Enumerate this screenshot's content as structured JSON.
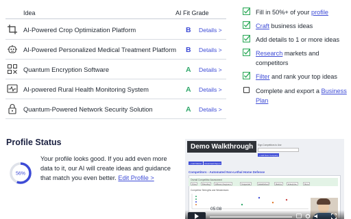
{
  "table": {
    "headers": {
      "idea": "Idea",
      "grade": "AI Fit Grade"
    },
    "rows": [
      {
        "name": "AI-Powered Crop Optimization Platform",
        "grade": "B",
        "details": "Details >"
      },
      {
        "name": "AI-Powered Personalized Medical Treatment Platform",
        "grade": "B",
        "details": "Details >"
      },
      {
        "name": "Quantum Encryption Software",
        "grade": "A",
        "details": "Details >"
      },
      {
        "name": "AI-powered Rural Health Monitoring System",
        "grade": "A",
        "details": "Details >"
      },
      {
        "name": "Quantum-Powered Network Security Solution",
        "grade": "A",
        "details": "Details >"
      }
    ],
    "icons": [
      "crop-icon",
      "robot-icon",
      "qr-icon",
      "monitor-pulse-icon",
      "lock-icon"
    ]
  },
  "checklist": [
    {
      "pre": "Fill in 50%+ of your ",
      "link": "profile",
      "post": "",
      "checked": true
    },
    {
      "pre": "",
      "link": "Craft",
      "post": " business ideas",
      "checked": true
    },
    {
      "pre": "Add details to 1 or more ideas",
      "link": "",
      "post": "",
      "checked": true
    },
    {
      "pre": "",
      "link": "Research",
      "post": " markets and competitors",
      "checked": true
    },
    {
      "pre": "",
      "link": "Filter",
      "post": " and rank your top ideas",
      "checked": true
    },
    {
      "pre": "Complete and export a ",
      "link": "Business Plan",
      "post": "",
      "checked": false
    }
  ],
  "profile": {
    "title": "Profile Status",
    "percent_label": "56%",
    "percent": 56,
    "text": "Your profile looks good. If you add even more data to it, our AI will create ideas and guidance that match you even better. ",
    "link": "Edit Profile >"
  },
  "video": {
    "title": "Demo Walkthrough",
    "app_title": "Competitors - Automated Non-Lethal Home Defense",
    "time": "05:08",
    "sub_label": "Sign Competitors to Use",
    "sub_btn": "+ Add New Company",
    "left_btn1": "+ Add Market",
    "left_btn2": "Download Report",
    "overall_label": "Overall Competitive Assessment",
    "strengths_label": "Competitor Strengths and Weaknesses",
    "tabs": [
      "Price",
      "Branding",
      "Different Segment",
      "Tangential",
      "Established",
      "Metrics",
      "Enterprise",
      "More"
    ]
  },
  "colors": {
    "accent": "#3d4bd6",
    "green": "#31a86b",
    "check": "#2faa5a"
  }
}
